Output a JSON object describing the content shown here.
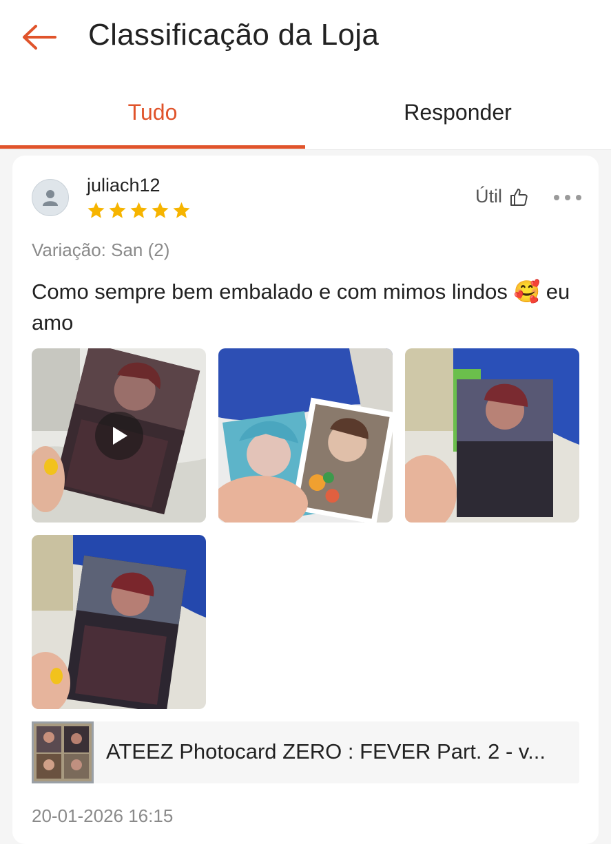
{
  "header": {
    "title": "Classificação da Loja",
    "back_icon": "arrow-left-icon",
    "accent_color": "#e0542b"
  },
  "tabs": [
    {
      "label": "Tudo",
      "active": true
    },
    {
      "label": "Responder",
      "active": false
    }
  ],
  "review": {
    "username": "juliach12",
    "rating": 5,
    "rating_max": 5,
    "helpful_label": "Útil",
    "helpful_icon": "thumbs-up-icon",
    "more_icon": "more-dots-icon",
    "variation": "Variação: San (2)",
    "comment": "Como sempre bem embalado e com mimos lindos 🥰 eu amo",
    "media": [
      {
        "type": "video",
        "icon": "play-icon"
      },
      {
        "type": "image"
      },
      {
        "type": "image"
      },
      {
        "type": "image"
      }
    ],
    "product_name": "ATEEZ Photocard ZERO : FEVER Part. 2 - v...",
    "date": "20-01-2026 16:15",
    "star_color": "#f6b400"
  }
}
